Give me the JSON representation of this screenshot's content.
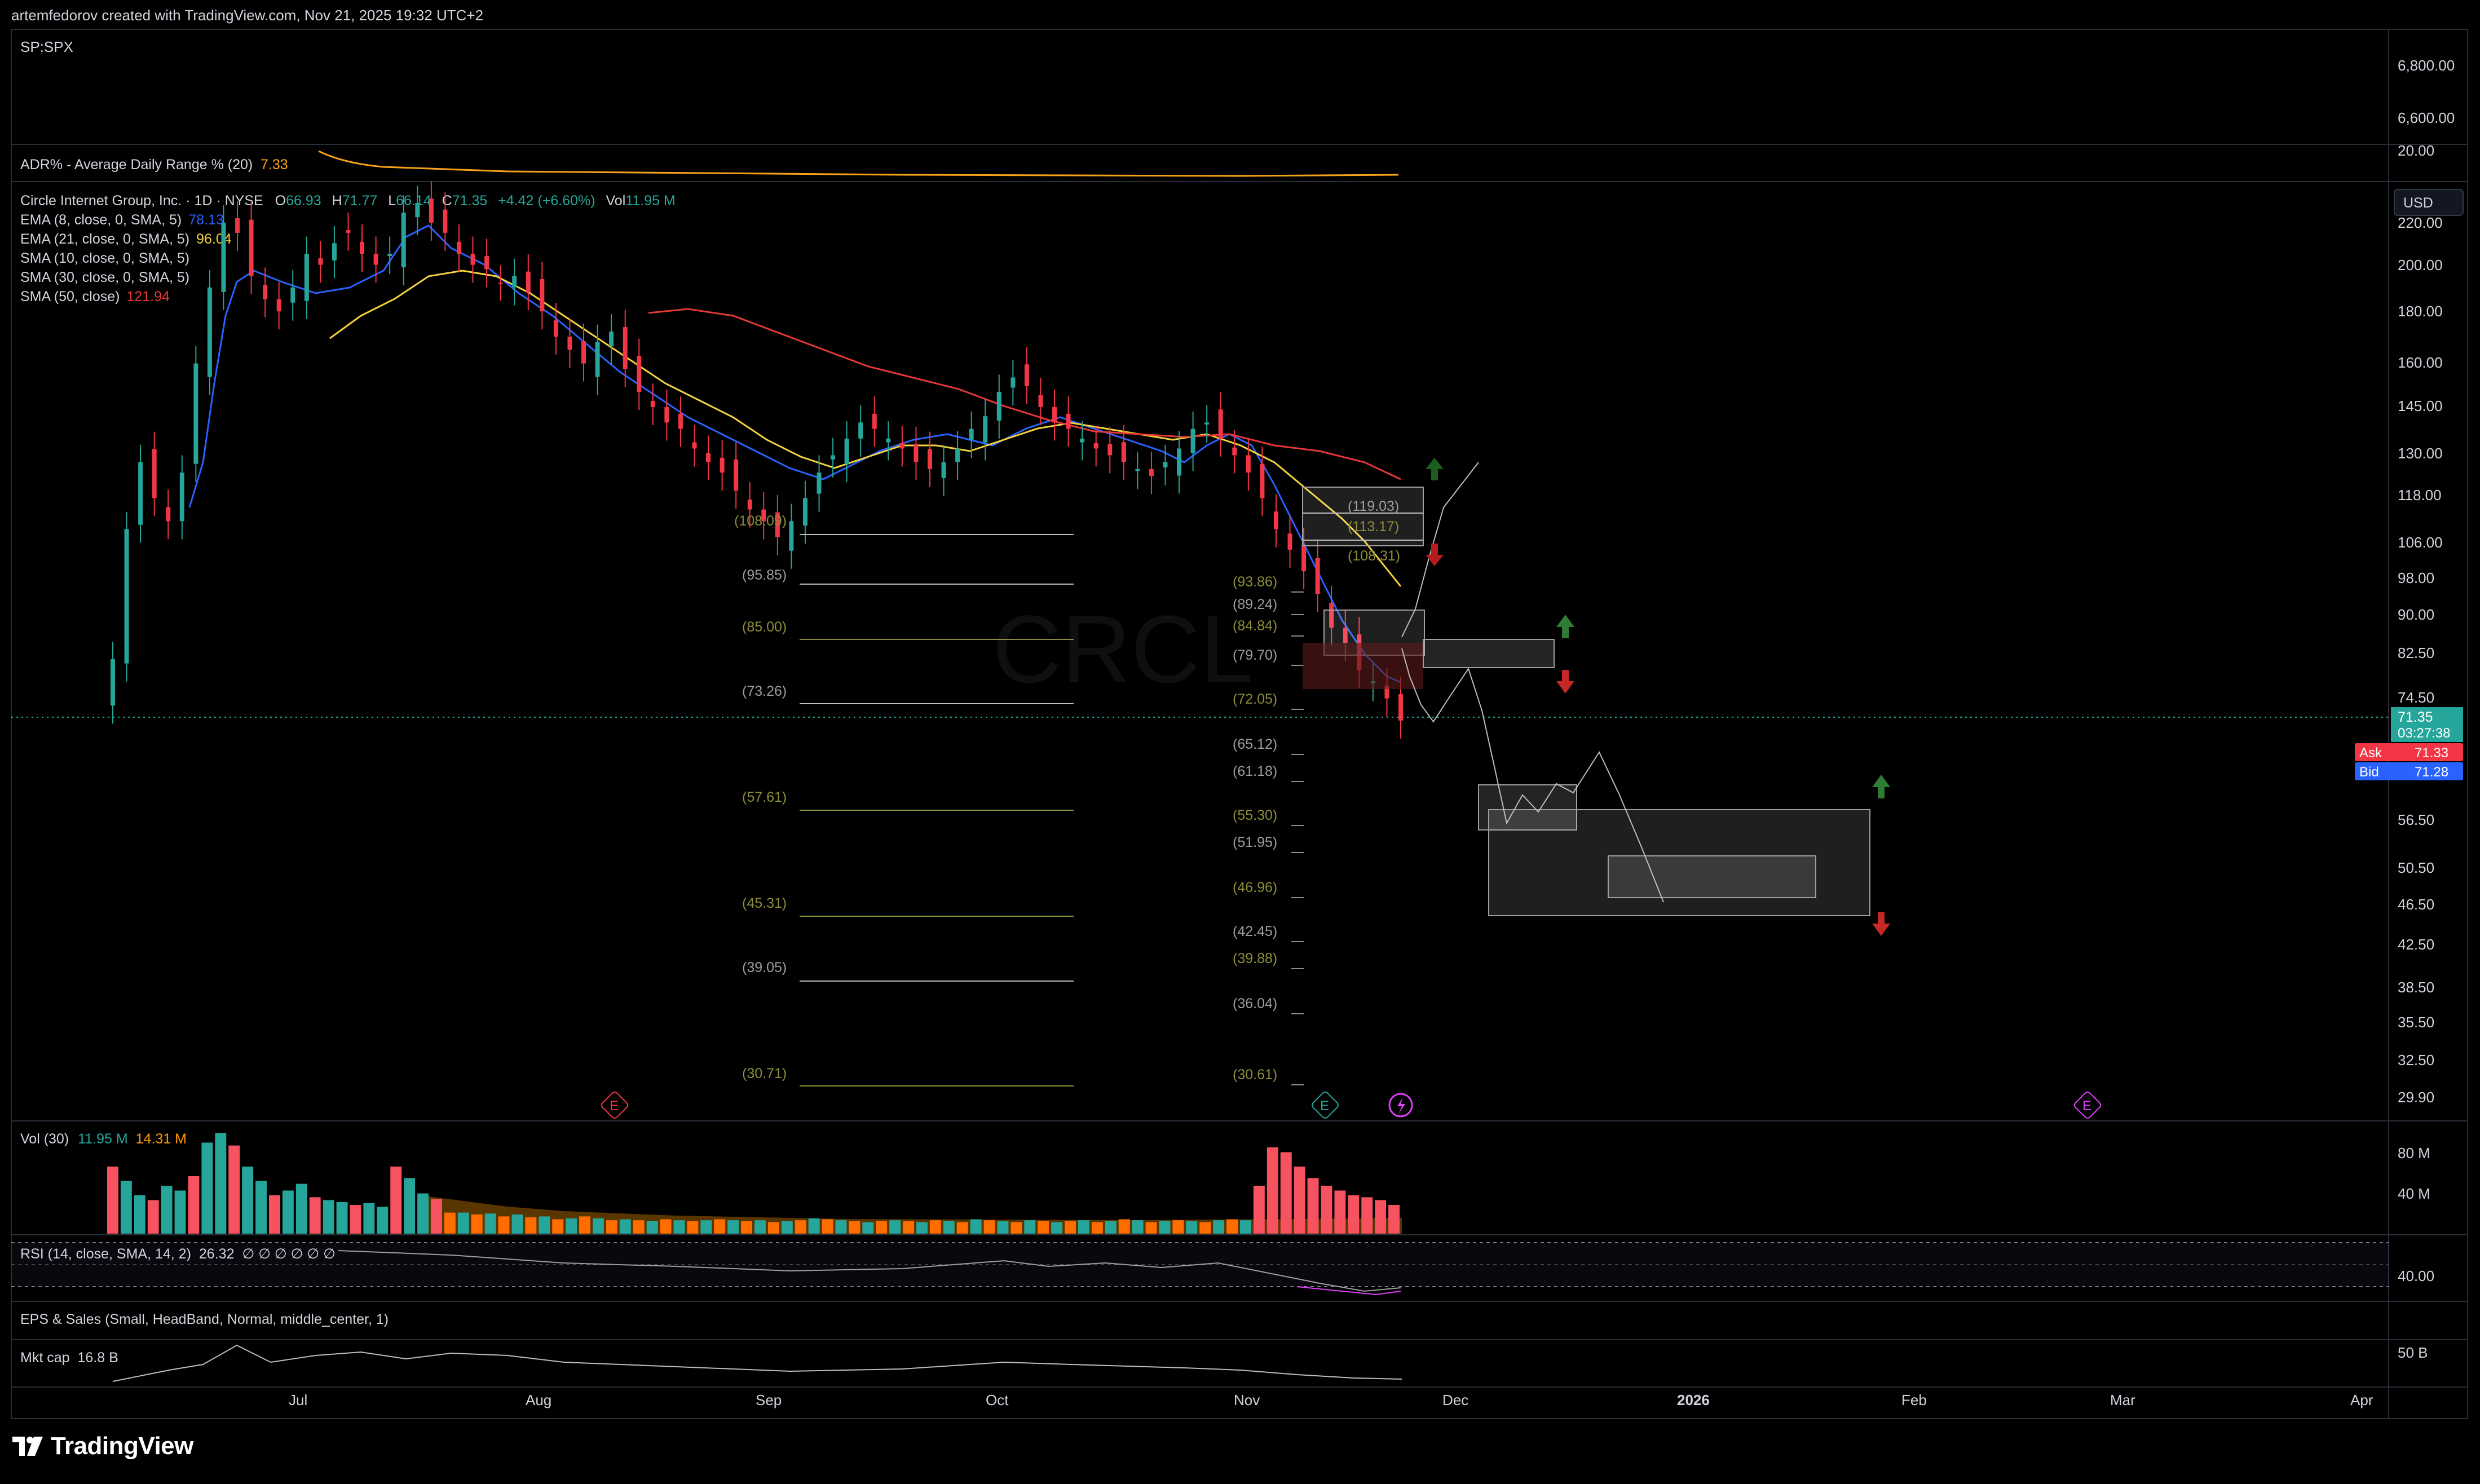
{
  "header": {
    "credit": "artemfedorov created with TradingView.com, Nov 21, 2025 19:32 UTC+2"
  },
  "footer": {
    "brand": "TradingView"
  },
  "top_pane": {
    "symbol": "SP:SPX",
    "ticks": [
      "6,800.00",
      "6,600.00"
    ]
  },
  "adr_pane": {
    "label": "ADR% - Average Daily Range % (20)",
    "value": "7.33",
    "tick": "20.00",
    "color": "#f7a21b"
  },
  "main_pane": {
    "title": "Circle Internet Group, Inc. · 1D · NYSE",
    "ohlc": [
      {
        "k": "O",
        "v": "66.93"
      },
      {
        "k": "H",
        "v": "71.77"
      },
      {
        "k": "L",
        "v": "66.14"
      },
      {
        "k": "C",
        "v": "71.35"
      },
      {
        "k": "",
        "v": "+4.42 (+6.60%)"
      },
      {
        "k": "Vol",
        "v": "11.95 M"
      }
    ],
    "indicators": [
      {
        "label": "EMA (8, close, 0, SMA, 5)",
        "value": "78.13",
        "color": "#2962ff"
      },
      {
        "label": "EMA (21, close, 0, SMA, 5)",
        "value": "96.04",
        "color": "#f5d33c"
      },
      {
        "label": "SMA (10, close, 0, SMA, 5)",
        "value": "",
        "color": "#d1d4dc"
      },
      {
        "label": "SMA (30, close, 0, SMA, 5)",
        "value": "",
        "color": "#d1d4dc"
      },
      {
        "label": "SMA (50, close)",
        "value": "121.94",
        "color": "#e53935"
      }
    ],
    "currency": "USD",
    "watermark": "CRCL",
    "price_ticks": [
      "220.00",
      "200.00",
      "180.00",
      "160.00",
      "145.00",
      "130.00",
      "118.00",
      "106.00",
      "98.00",
      "90.00",
      "82.50",
      "74.50",
      "56.50",
      "50.50",
      "46.50",
      "42.50",
      "38.50",
      "35.50",
      "32.50",
      "29.90"
    ],
    "last_price": {
      "price": "71.35",
      "countdown": "03:27:38",
      "color": "#26a69a"
    },
    "ask": {
      "label": "Ask",
      "value": "71.33",
      "color": "#f23645"
    },
    "bid": {
      "label": "Bid",
      "value": "71.28",
      "color": "#2962ff"
    },
    "fib_left": [
      "(108.09)",
      "(95.85)",
      "(85.00)",
      "(73.26)",
      "(57.61)",
      "(45.31)",
      "(39.05)",
      "(30.71)"
    ],
    "fib_right": [
      "(93.86)",
      "(89.24)",
      "(84.84)",
      "(79.70)",
      "(72.05)",
      "(65.12)",
      "(61.18)",
      "(55.30)",
      "(51.95)",
      "(46.96)",
      "(42.45)",
      "(39.88)",
      "(36.04)",
      "(30.61)"
    ],
    "fib_box": [
      "(119.03)",
      "(113.17)",
      "(108.31)"
    ],
    "event_markers": [
      "E",
      "E",
      "E"
    ]
  },
  "time_axis": [
    "Jul",
    "Aug",
    "Sep",
    "Oct",
    "Nov",
    "Dec",
    "2026",
    "Feb",
    "Mar",
    "Apr"
  ],
  "volume_pane": {
    "label": "Vol (30)",
    "value1": "11.95 M",
    "value2": "14.31 M",
    "ticks": [
      "80 M",
      "40 M"
    ]
  },
  "rsi_pane": {
    "label": "RSI (14, close, SMA, 14, 2)",
    "value": "26.32",
    "tail": "∅ ∅ ∅ ∅ ∅ ∅",
    "tick": "40.00"
  },
  "eps_pane": {
    "label": "EPS & Sales (Small, HeadBand, Normal, middle_center, 1)"
  },
  "mcap_pane": {
    "label": "Mkt cap",
    "value": "16.8 B",
    "tick": "50 B"
  },
  "chart_data": {
    "type": "candlestick",
    "symbol": "CRCL",
    "timeframe": "1D",
    "y_scale": "log",
    "ylim": [
      29.9,
      230
    ],
    "last": {
      "open": 66.93,
      "high": 71.77,
      "low": 66.14,
      "close": 71.35,
      "change": 4.42,
      "change_pct": 6.6
    },
    "ohlc_closes": [
      82,
      110,
      128,
      118,
      112,
      125,
      160,
      190,
      220,
      215,
      195,
      185,
      180,
      190,
      205,
      200,
      210,
      215,
      205,
      200,
      205,
      225,
      230,
      220,
      215,
      205,
      200,
      198,
      192,
      195,
      188,
      180,
      170,
      165,
      160,
      168,
      172,
      158,
      150,
      145,
      140,
      138,
      132,
      128,
      125,
      120,
      115,
      112,
      108,
      112,
      118,
      125,
      130,
      135,
      140,
      138,
      135,
      132,
      128,
      126,
      128,
      132,
      138,
      142,
      150,
      155,
      152,
      145,
      140,
      138,
      135,
      132,
      130,
      128,
      126,
      124,
      128,
      132,
      138,
      140,
      135,
      130,
      125,
      118,
      110,
      105,
      100,
      95,
      88,
      85,
      80,
      78,
      75,
      71.35
    ],
    "series": [
      {
        "name": "EMA (8, close, 0, SMA, 5)",
        "last": 78.13
      },
      {
        "name": "EMA (21, close, 0, SMA, 5)",
        "last": 96.04
      },
      {
        "name": "SMA (50, close)",
        "last": 121.94
      }
    ],
    "volume_m": [
      70,
      55,
      40,
      35,
      50,
      45,
      60,
      95,
      105,
      92,
      70,
      55,
      40,
      45,
      52,
      38,
      35,
      33,
      30,
      32,
      28,
      70,
      58,
      42,
      36,
      22,
      22,
      20,
      21,
      18,
      20,
      17,
      18,
      15,
      16,
      18,
      16,
      14,
      15,
      14,
      13,
      15,
      14,
      13,
      14,
      15,
      14,
      13,
      14,
      12,
      13,
      14,
      16,
      15,
      14,
      13,
      12,
      13,
      14,
      13,
      12,
      14,
      13,
      12,
      15,
      14,
      13,
      12,
      14,
      13,
      12,
      13,
      14,
      12,
      13,
      15,
      14,
      12,
      13,
      14,
      13,
      12,
      14,
      15,
      14,
      50,
      90,
      85,
      70,
      58,
      50,
      45,
      40,
      38,
      35,
      30
    ],
    "annotation_levels_left": [
      108.09,
      95.85,
      85.0,
      73.26,
      57.61,
      45.31,
      39.05,
      30.71
    ],
    "annotation_levels_right": [
      93.86,
      89.24,
      84.84,
      79.7,
      72.05,
      65.12,
      61.18,
      55.3,
      51.95,
      46.96,
      42.45,
      39.88,
      36.04,
      30.61
    ],
    "annotation_levels_box": [
      119.03,
      113.17,
      108.31
    ]
  },
  "colors": {
    "up": "#26a69a",
    "down": "#f23645",
    "vol_up": "#26a69a",
    "vol_down": "#f7525f",
    "vol_orange": "#ff6d00",
    "fib": "#8d8d3a",
    "grid": "#2a2e39"
  }
}
